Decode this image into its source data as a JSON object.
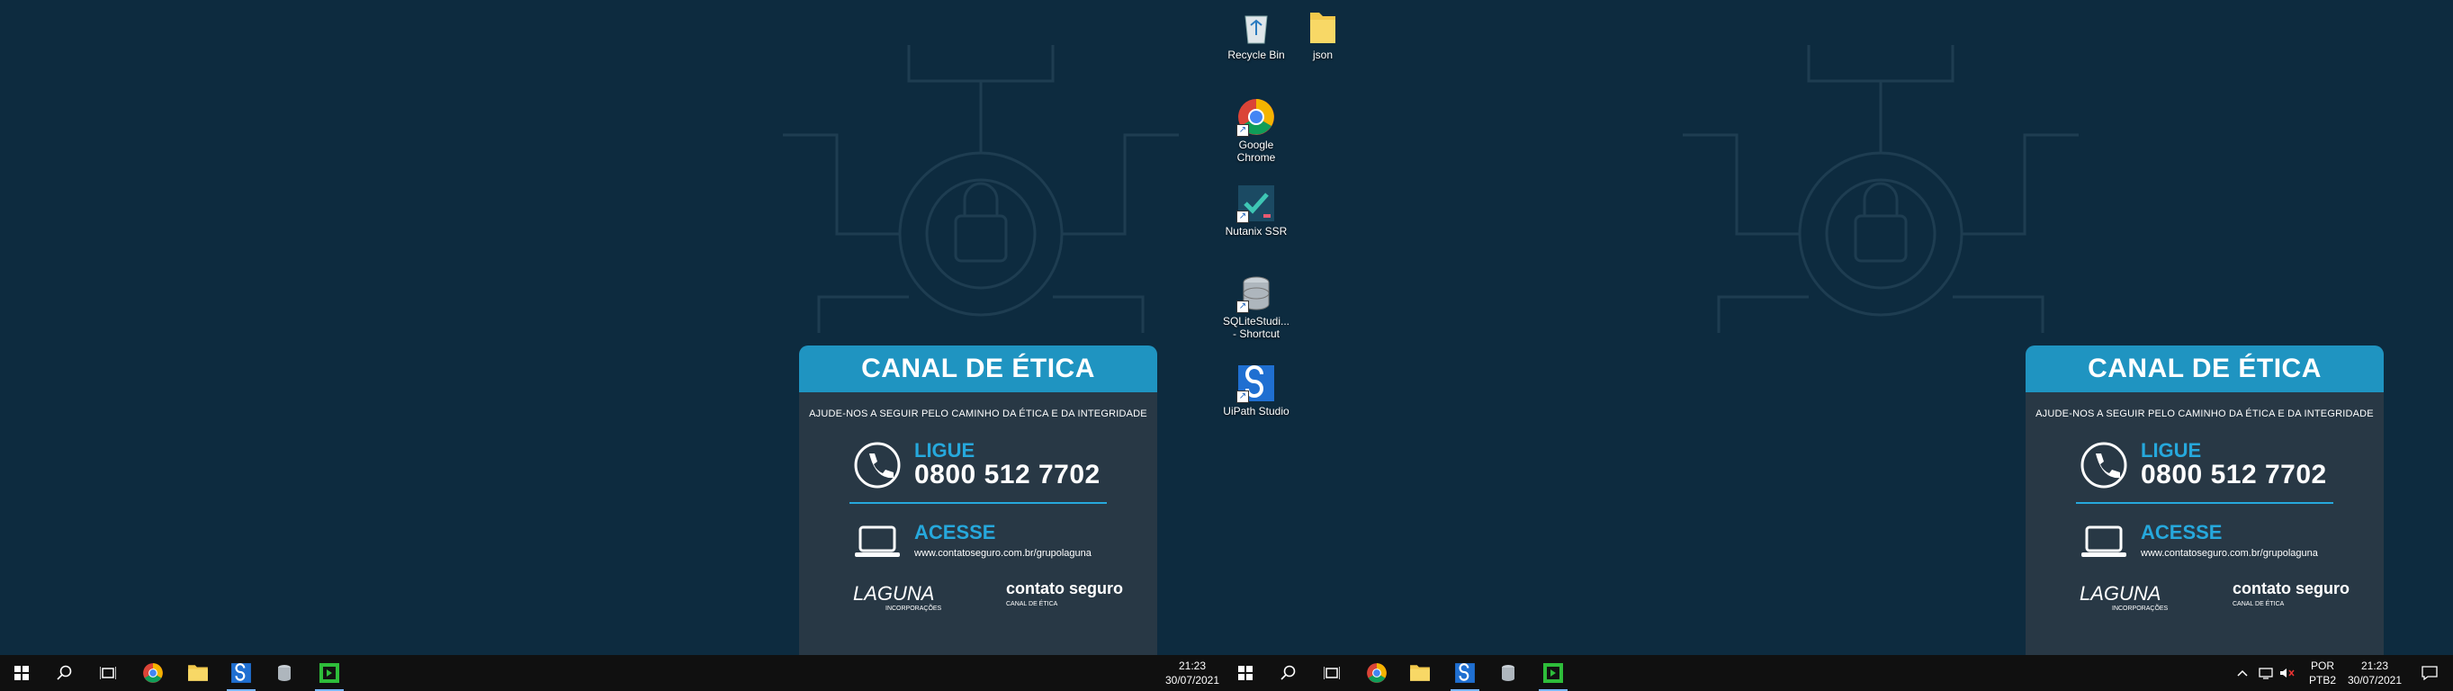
{
  "wallpaper": {
    "card_title": "CANAL DE ÉTICA",
    "card_subtitle": "AJUDE-NOS A SEGUIR PELO CAMINHO DA ÉTICA E DA INTEGRIDADE",
    "call_label": "LIGUE",
    "phone": "0800 512 7702",
    "web_label": "ACESSE",
    "url": "www.contatoseguro.com.br/grupolaguna",
    "logo_laguna": "LAGUNA",
    "logo_laguna_tag": "INCORPORAÇÕES",
    "logo_contato": "contato seguro",
    "logo_contato_tag": "CANAL DE ÉTICA"
  },
  "desktop_icons": [
    {
      "label": "Recycle Bin",
      "icon": "recycle-bin-icon"
    },
    {
      "label": "json",
      "icon": "folder-icon"
    },
    {
      "label": "Google Chrome",
      "icon": "chrome-icon"
    },
    {
      "label": "Nutanix SSR",
      "icon": "nutanix-icon"
    },
    {
      "label": "SQLiteStudi... - Shortcut",
      "icon": "sqlite-icon"
    },
    {
      "label": "UiPath Studio",
      "icon": "uipath-icon"
    }
  ],
  "taskbar": {
    "left_clock": {
      "time": "21:23",
      "date": "30/07/2021"
    },
    "right_clock": {
      "time": "21:23",
      "date": "30/07/2021"
    },
    "language": "POR",
    "keyboard": "PTB2"
  },
  "colors": {
    "accent": "#1f94c1",
    "background": "#0d2b3f",
    "card": "#283845"
  }
}
